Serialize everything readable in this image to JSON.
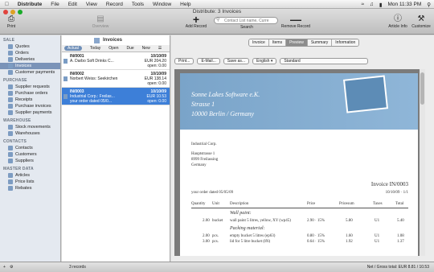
{
  "menubar": {
    "app": "Distribute",
    "items": [
      "File",
      "Edit",
      "View",
      "Record",
      "Tools",
      "Window",
      "Help"
    ],
    "datetime": "Mon 11:33 PM"
  },
  "window": {
    "title": "Distribute: 3 Invoices"
  },
  "toolbar": {
    "print": "Print",
    "overview": "Overview",
    "add": "Add Record",
    "search_label": "Search",
    "search_placeholder": "Contact List name, Curre",
    "remove": "Remove Record",
    "info": "Article Info",
    "customize": "Customize"
  },
  "sidebar": {
    "sections": [
      {
        "title": "SALE",
        "items": [
          "Quotes",
          "Orders",
          "Deliveries",
          "Invoices",
          "Customer payments"
        ]
      },
      {
        "title": "PURCHASE",
        "items": [
          "Supplier requests",
          "Purchase orders",
          "Receipts",
          "Purchase invoices",
          "Supplier payments"
        ]
      },
      {
        "title": "WAREHOUSE",
        "items": [
          "Stock movements",
          "Warehouses"
        ]
      },
      {
        "title": "CONTACTS",
        "items": [
          "Contacts",
          "Customers",
          "Suppliers"
        ]
      },
      {
        "title": "MASTER DATA",
        "items": [
          "Articles",
          "Price lists",
          "Rebates"
        ]
      }
    ],
    "selected": "Invoices"
  },
  "list": {
    "title": "Invoices",
    "filters": [
      "Actual",
      "Today",
      "Open",
      "Due",
      "New"
    ],
    "rows": [
      {
        "no": "IN/0001",
        "date": "10/10/09",
        "customer": "A. Darbo Soft Drinks C...",
        "amount": "EUR 204.20",
        "open": "open: 0.00",
        "extra": ""
      },
      {
        "no": "IN/0002",
        "date": "10/10/09",
        "customer": "Norbert Weiss: Seekirchen",
        "amount": "EUR 138.14",
        "open": "open: 0.00",
        "extra": ""
      },
      {
        "no": "IN/0003",
        "date": "10/10/09",
        "customer": "Industrial Corp.: Freilas...",
        "amount": "EUR 10.53",
        "open": "open: 0.00",
        "extra": "your order dated 05/0..."
      }
    ]
  },
  "detail": {
    "tabs": [
      "Invoice",
      "Items",
      "Preview",
      "Summary",
      "Information"
    ],
    "active_tab": "Preview",
    "print_toolbar": {
      "print": "Print...",
      "email": "E-Mail...",
      "save": "Save as...",
      "language": "English",
      "format": "Standard"
    },
    "doc": {
      "company": "Sonne Lakes Software e.K.",
      "street": "Strasse 1",
      "city": "10000 Berlin / Germany",
      "customer": "Industrial Corp.",
      "addr1": "Hauptstrasse 1",
      "addr2": "8999 Freilassing",
      "country": "Germany",
      "inv_title": "Invoice IN/0003",
      "order_ref": "your order dated 05/05/09",
      "inv_date": "10/10/09 · 1/1",
      "cols": [
        "Quantity",
        "Unit",
        "Description",
        "Price",
        "Pricesum",
        "Taxes",
        "Total"
      ],
      "groups": [
        "Wall paint:",
        "Packing material:"
      ],
      "lines": [
        {
          "q": "2.00",
          "u": "bucket",
          "d": "wall paint 5 litres, yellow, XY (wp45)",
          "p": "2.90 · 15%",
          "ps": "5.80",
          "tx": "U1",
          "t": "5.40"
        },
        {
          "q": "2.00",
          "u": "pcs.",
          "d": "empty bucket 5 litres (ep63)",
          "p": "0.80 · 15%",
          "ps": "1.60",
          "tx": "U1",
          "t": "1.08"
        },
        {
          "q": "3.00",
          "u": "pcs.",
          "d": "lid for 5 litre bucket (lf6)",
          "p": "0.64 · 15%",
          "ps": "1.92",
          "tx": "U1",
          "t": "1.37"
        }
      ]
    }
  },
  "status": {
    "records": "3 records",
    "totals": "Net / Gross total: EUR 8.81 / 10.53"
  }
}
